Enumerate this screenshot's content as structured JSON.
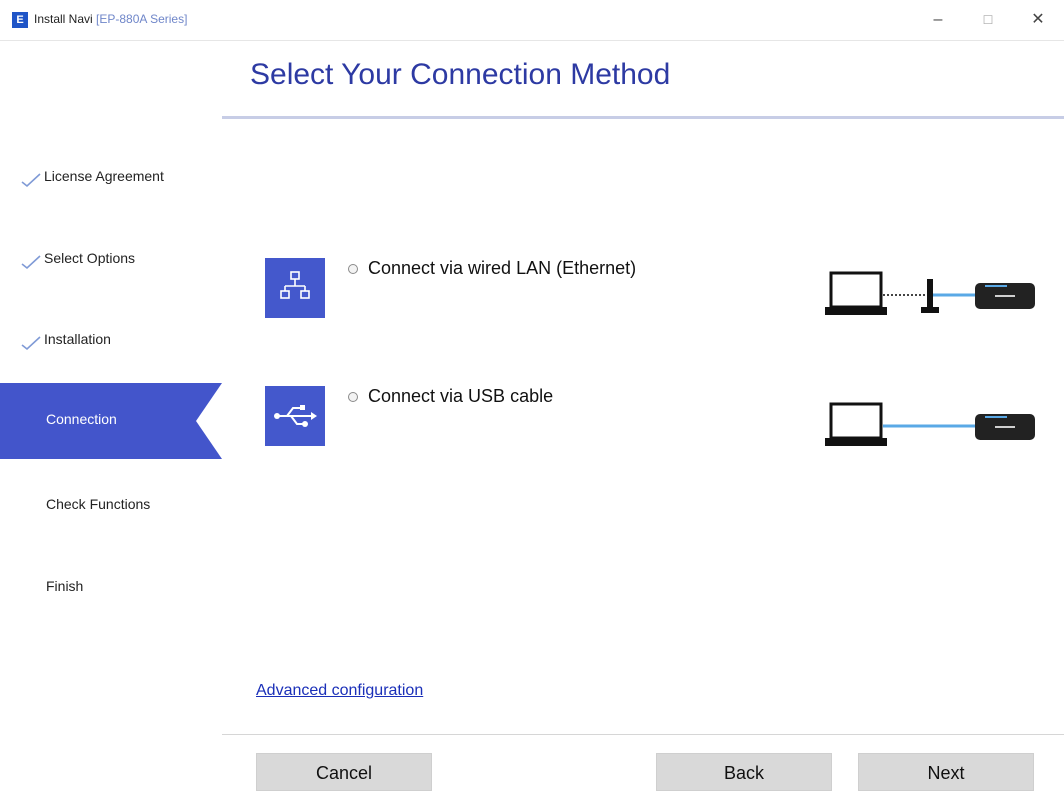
{
  "window": {
    "title": "Install Navi",
    "model": "[EP-880A Series]",
    "app_icon": "E",
    "minimize": "–",
    "maximize": "☐",
    "close": "✕"
  },
  "sidebar": {
    "steps": [
      {
        "label": "License Agreement",
        "state": "done"
      },
      {
        "label": "Select Options",
        "state": "done"
      },
      {
        "label": "Installation",
        "state": "done"
      },
      {
        "label": "Connection",
        "state": "active"
      },
      {
        "label": "Check Functions",
        "state": "pending"
      },
      {
        "label": "Finish",
        "state": "pending"
      }
    ],
    "active_color": "#4355cb"
  },
  "main": {
    "title": "Select Your Connection Method",
    "options": [
      {
        "label": "Connect via wired LAN (Ethernet)",
        "icon": "network-icon"
      },
      {
        "label": "Connect via USB cable",
        "icon": "usb-icon"
      }
    ],
    "advanced_link": "Advanced configuration"
  },
  "footer": {
    "cancel": "Cancel",
    "back": "Back",
    "next": "Next"
  },
  "colors": {
    "title": "#2d3aa3",
    "accent": "#4458cc",
    "cable": "#5aa9e6"
  }
}
